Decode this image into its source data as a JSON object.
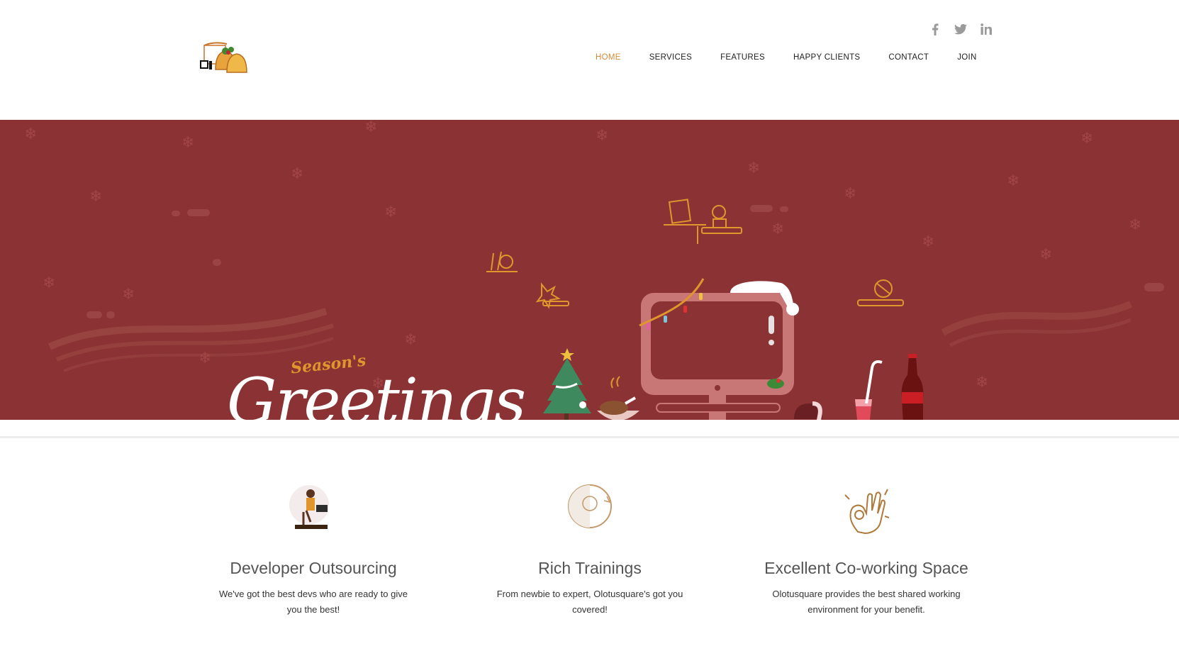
{
  "header": {
    "social": [
      {
        "icon": "facebook-icon",
        "label": "f"
      },
      {
        "icon": "twitter-icon",
        "label": "t"
      },
      {
        "icon": "linkedin-icon",
        "label": "in"
      }
    ],
    "nav": [
      "HOME",
      "SERVICES",
      "FEATURES",
      "HAPPY CLIENTS",
      "CONTACT",
      "JOIN"
    ],
    "active_nav": "HOME"
  },
  "hero": {
    "subtitle": "Season's",
    "title": "Greetings"
  },
  "features": [
    {
      "title": "Developer Outsourcing",
      "text": "We've got the best devs who are ready to give you the best!"
    },
    {
      "title": "Rich Trainings",
      "text": "From newbie to expert, Olotusquare's got you covered!"
    },
    {
      "title": "Excellent Co-working Space",
      "text": "Olotusquare provides the best shared working environment for your benefit."
    }
  ],
  "colors": {
    "hero_bg": "#8a3234",
    "accent": "#d58a3a",
    "nav_text": "#222222"
  }
}
